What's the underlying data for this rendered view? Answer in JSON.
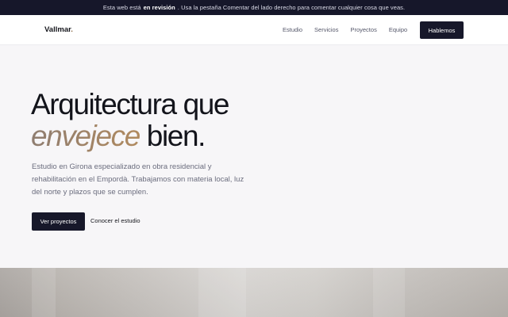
{
  "banner": {
    "before": "Esta web está",
    "strong": "en revisión",
    "after": ". Usa la pestaña Comentar del lado derecho para comentar cualquier cosa que veas."
  },
  "header": {
    "logo": "Vallmar",
    "logo_dot": ".",
    "nav": [
      "Estudio",
      "Servicios",
      "Proyectos",
      "Equipo"
    ],
    "cta": "Hablemos"
  },
  "hero": {
    "title_line1": "Arquitectura que",
    "title_accent": "envejece",
    "title_rest": " bien.",
    "description": "Estudio en Girona especializado en obra residencial y rehabilitación en el Empordà. Trabajamos con materia local, luz del norte y plazos que se cumplen.",
    "primary_button": "Ver proyectos",
    "secondary_link": "Conocer el estudio"
  },
  "colors": {
    "banner_bg": "#16172a",
    "dark_button": "#17182a",
    "accent": "#9a7a57",
    "page_bg": "#f7f6f8"
  }
}
